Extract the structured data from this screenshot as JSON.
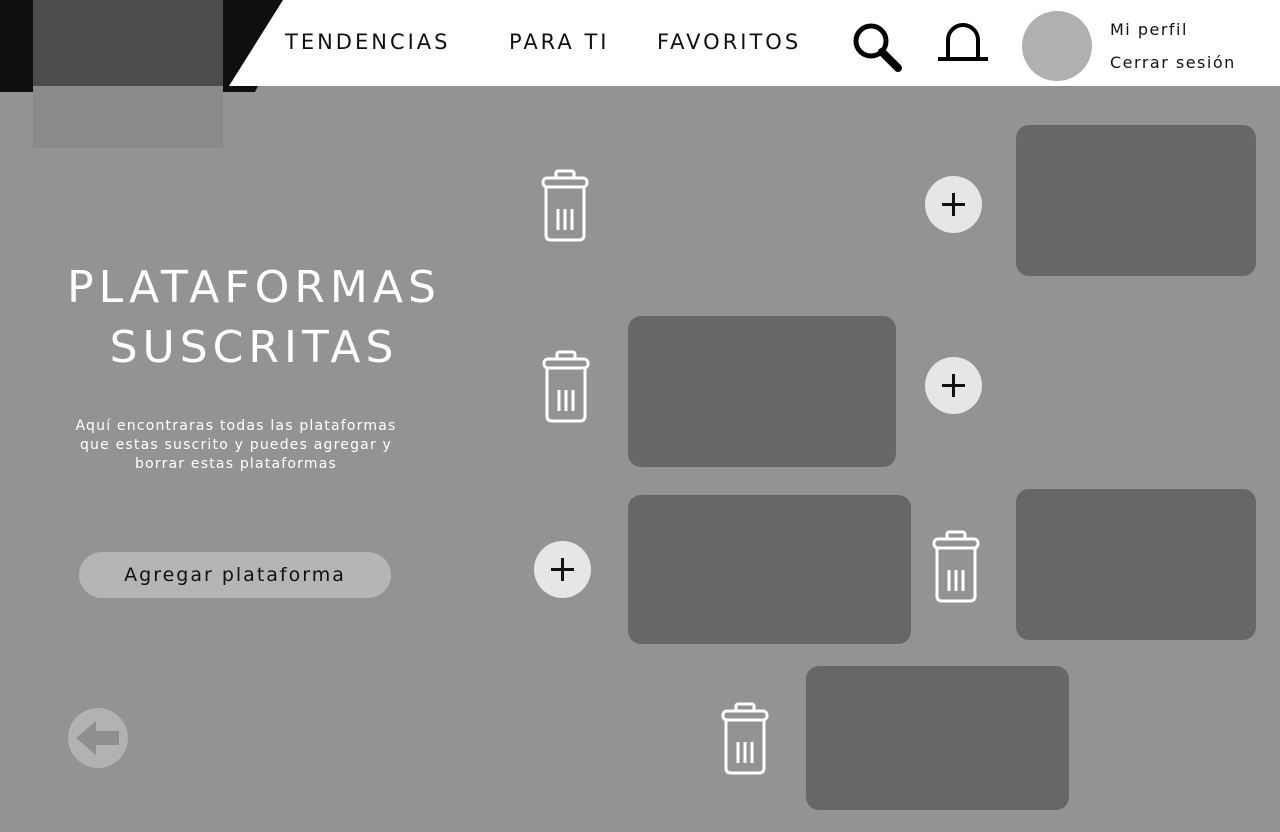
{
  "header": {
    "nav": [
      "TENDENCIAS",
      "PARA TI",
      "FAVORITOS"
    ],
    "icons": {
      "search": "search-icon",
      "notifications": "bell-icon"
    },
    "profile": {
      "my_profile": "Mi perfil",
      "logout": "Cerrar sesión"
    }
  },
  "main": {
    "title_lines": [
      "PLATAFORMAS",
      "SUSCRITAS"
    ],
    "description": "Aquí encontraras todas las plataformas que estas suscrito y puedes agregar y borrar estas plataformas",
    "add_button": "Agregar plataforma",
    "back_icon": "back-arrow-icon"
  },
  "colors": {
    "background": "#939393",
    "card": "#676767",
    "plus_button": "#e6e6e9",
    "header_dark": "#0f0f0f"
  }
}
